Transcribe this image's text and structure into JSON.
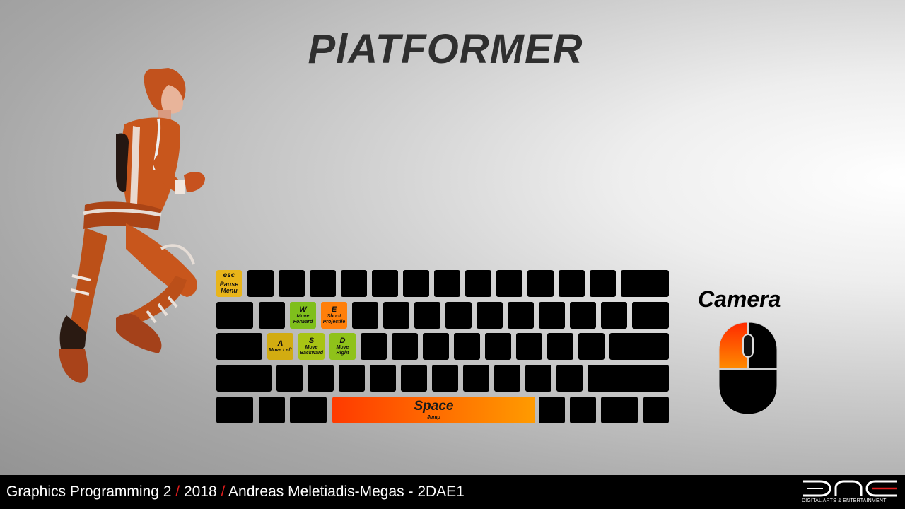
{
  "title": "PlATFORMER",
  "keyboard": {
    "esc": {
      "key": "esc",
      "action": "Pause Menu"
    },
    "w": {
      "key": "W",
      "action": "Move Forward"
    },
    "e": {
      "key": "E",
      "action": "Shoot Projectile"
    },
    "a": {
      "key": "A",
      "action": "Move Left"
    },
    "s": {
      "key": "S",
      "action": "Move Backward"
    },
    "d": {
      "key": "D",
      "action": "Move Right"
    },
    "space": {
      "key": "Space",
      "action": "Jump"
    }
  },
  "camera": {
    "label": "Camera"
  },
  "footer": {
    "course": "Graphics Programming 2",
    "separator": "/",
    "year": "2018",
    "author": "Andreas Meletiadis-Megas - 2DAE1"
  },
  "logo": {
    "caption": "DIGITAL ARTS & ENTERTAINMENT"
  },
  "colors": {
    "highlight_orange": "#ff7f0a",
    "highlight_green": "#7fbf1c",
    "highlight_yellow": "#e9b51a",
    "footer_accent": "#e11d1d"
  }
}
